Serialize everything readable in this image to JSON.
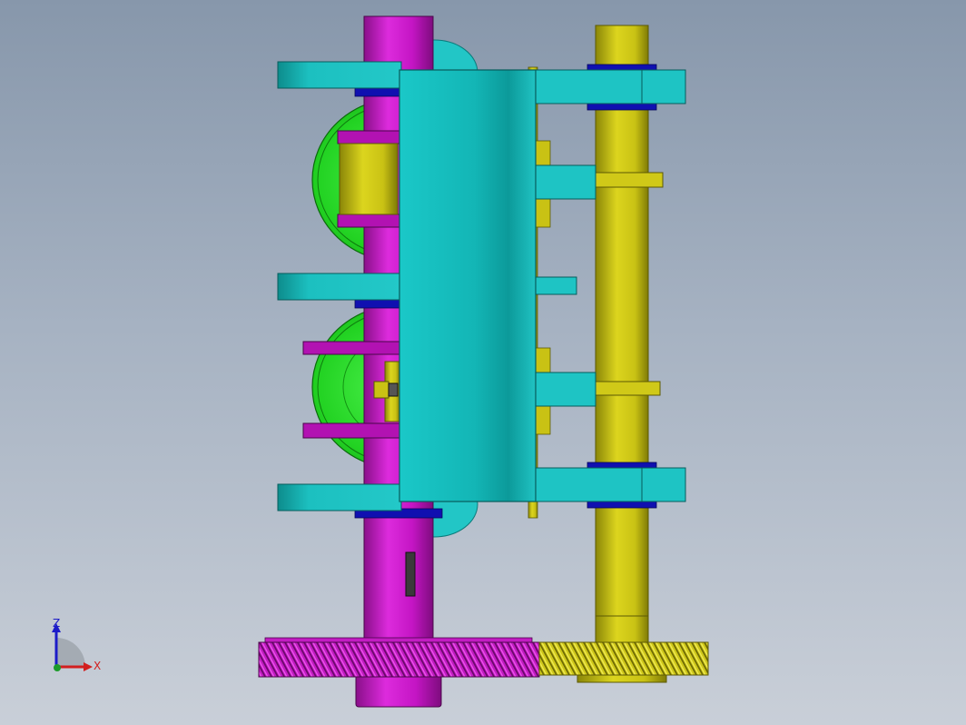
{
  "viewport": {
    "background_top": "#8797ab",
    "background_bottom": "#c9cfd8"
  },
  "triad": {
    "z_label": "Z",
    "x_label": "X",
    "z_color": "#1c1cc8",
    "x_color": "#d21e1e",
    "y_color": "#1c9b2a"
  },
  "colors": {
    "magenta_shaft": "#c415c4",
    "yellow_shaft": "#c9c214",
    "cyan_housing": "#1fc0c0",
    "green_gear": "#22d222",
    "blue_bearing": "#1010b0"
  }
}
